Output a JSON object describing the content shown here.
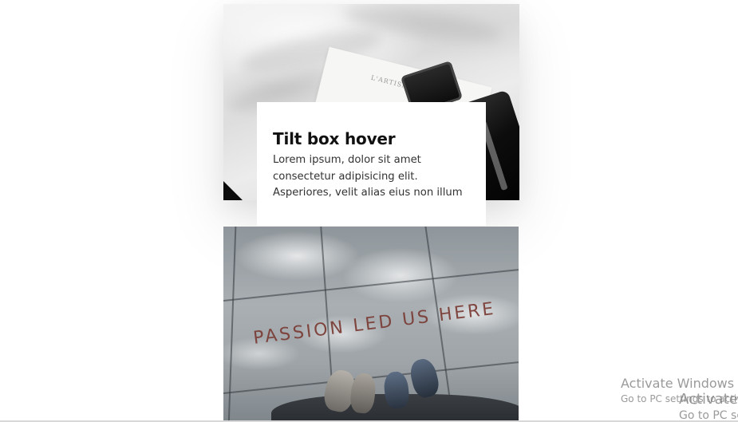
{
  "card_top": {
    "photo_label": "perfume bottle on white fabric",
    "paper_text": "L'ARTISAN",
    "title": "Tilt box hover",
    "body": "Lorem ipsum, dolor sit amet\nconsectetur adipisicing elit.\nAsperiores, velit alias eius non illum"
  },
  "card_bottom": {
    "floor_text": "PASSION LED US HERE"
  },
  "watermark": {
    "line1": "Activate Windows",
    "line2": "Go to PC settings to activate Windows.",
    "line1_dup": "Activate",
    "line2_dup": "Go to PC se"
  },
  "colors": {
    "background": "#ffffff",
    "title": "#111111",
    "body": "#333333",
    "floor_text": "#7a3b34"
  }
}
